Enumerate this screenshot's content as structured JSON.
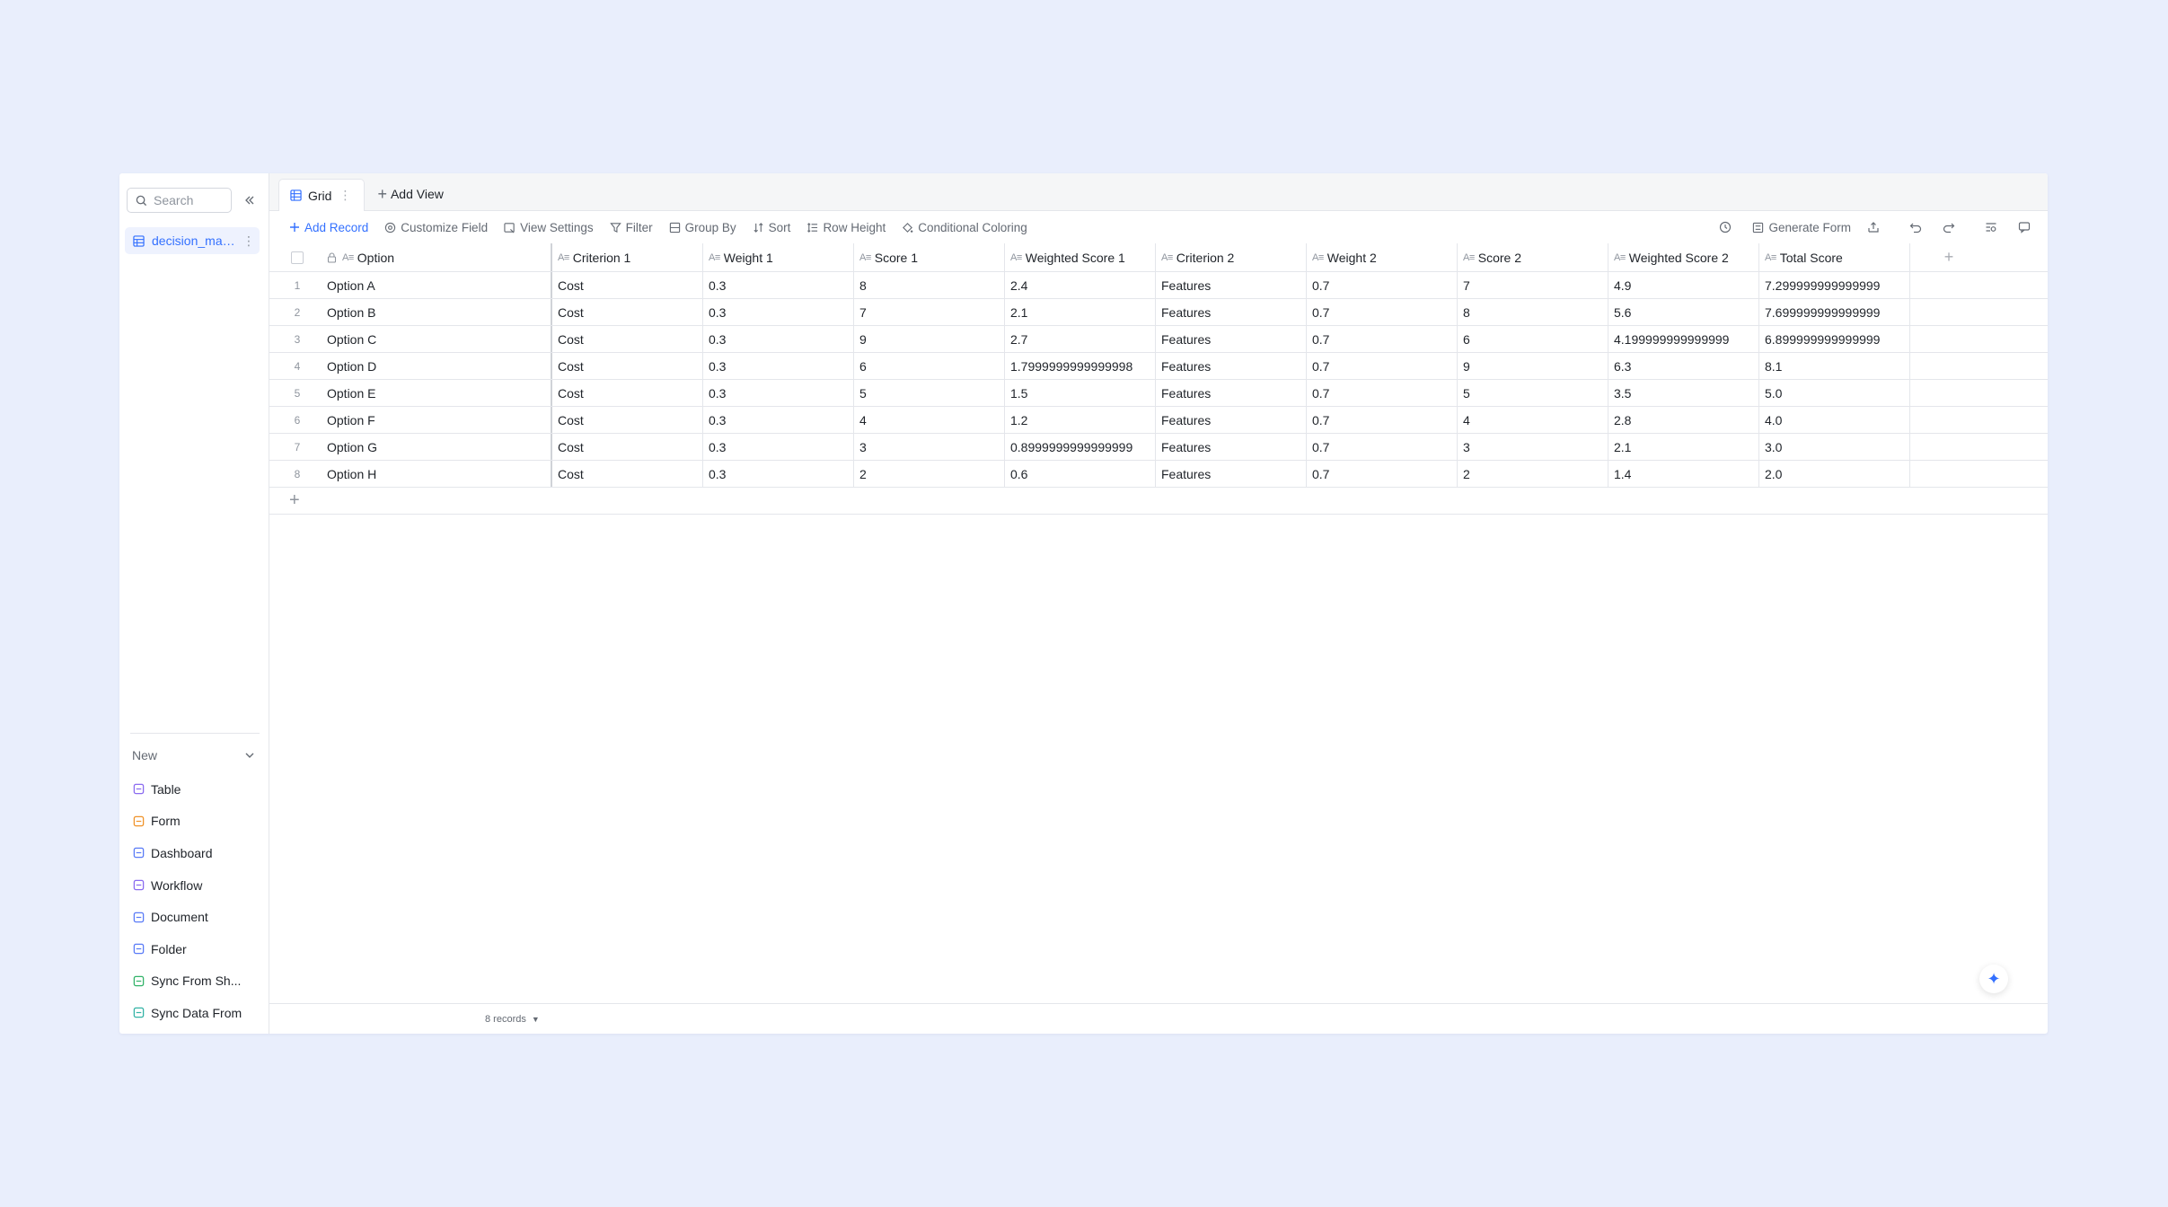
{
  "sidebar": {
    "search_placeholder": "Search",
    "tree_item": "decision_matr...",
    "new_label": "New",
    "new_items": [
      {
        "label": "Table",
        "icon": "table-icon",
        "color": "#8b6cf0"
      },
      {
        "label": "Form",
        "icon": "form-icon",
        "color": "#f0932b"
      },
      {
        "label": "Dashboard",
        "icon": "dashboard-icon",
        "color": "#5b7cf7"
      },
      {
        "label": "Workflow",
        "icon": "workflow-icon",
        "color": "#8b6cf0"
      },
      {
        "label": "Document",
        "icon": "document-icon",
        "color": "#5b7cf7"
      },
      {
        "label": "Folder",
        "icon": "folder-icon",
        "color": "#5b7cf7"
      },
      {
        "label": "Sync From Sh...",
        "icon": "sync-sheet-icon",
        "color": "#34b36a"
      },
      {
        "label": "Sync Data From",
        "icon": "sync-data-icon",
        "color": "#34b3a6"
      }
    ]
  },
  "tabs": {
    "active": "Grid",
    "add_view": "Add View"
  },
  "toolbar": {
    "add_record": "Add Record",
    "customize_field": "Customize Field",
    "view_settings": "View Settings",
    "filter": "Filter",
    "group_by": "Group By",
    "sort": "Sort",
    "row_height": "Row Height",
    "conditional_coloring": "Conditional Coloring",
    "generate_form": "Generate Form"
  },
  "table": {
    "columns": [
      "Option",
      "Criterion 1",
      "Weight 1",
      "Score 1",
      "Weighted Score 1",
      "Criterion 2",
      "Weight 2",
      "Score 2",
      "Weighted Score 2",
      "Total Score"
    ],
    "rows": [
      [
        "1",
        "Option A",
        "Cost",
        "0.3",
        "8",
        "2.4",
        "Features",
        "0.7",
        "7",
        "4.9",
        "7.299999999999999"
      ],
      [
        "2",
        "Option B",
        "Cost",
        "0.3",
        "7",
        "2.1",
        "Features",
        "0.7",
        "8",
        "5.6",
        "7.699999999999999"
      ],
      [
        "3",
        "Option C",
        "Cost",
        "0.3",
        "9",
        "2.7",
        "Features",
        "0.7",
        "6",
        "4.199999999999999",
        "6.899999999999999"
      ],
      [
        "4",
        "Option D",
        "Cost",
        "0.3",
        "6",
        "1.7999999999999998",
        "Features",
        "0.7",
        "9",
        "6.3",
        "8.1"
      ],
      [
        "5",
        "Option E",
        "Cost",
        "0.3",
        "5",
        "1.5",
        "Features",
        "0.7",
        "5",
        "3.5",
        "5.0"
      ],
      [
        "6",
        "Option F",
        "Cost",
        "0.3",
        "4",
        "1.2",
        "Features",
        "0.7",
        "4",
        "2.8",
        "4.0"
      ],
      [
        "7",
        "Option G",
        "Cost",
        "0.3",
        "3",
        "0.8999999999999999",
        "Features",
        "0.7",
        "3",
        "2.1",
        "3.0"
      ],
      [
        "8",
        "Option H",
        "Cost",
        "0.3",
        "2",
        "0.6",
        "Features",
        "0.7",
        "2",
        "1.4",
        "2.0"
      ]
    ]
  },
  "footer": {
    "record_count": "8 records"
  }
}
